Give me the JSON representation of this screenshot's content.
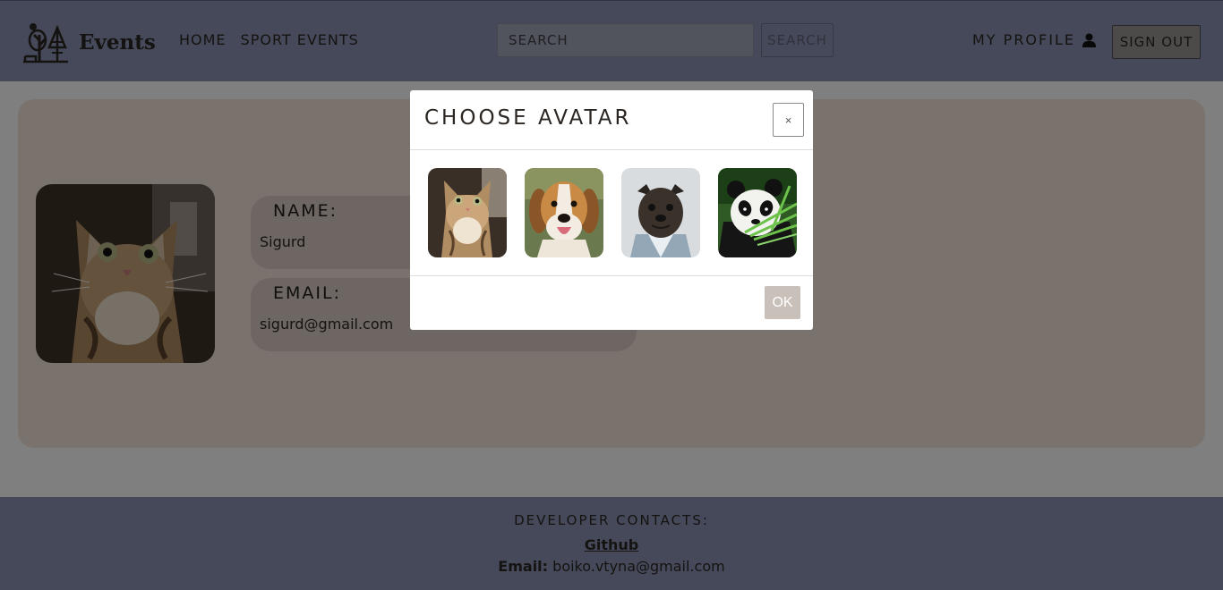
{
  "header": {
    "logo_text": "Events",
    "nav": [
      "HOME",
      "SPORT EVENTS"
    ],
    "search_placeholder": "SEARCH",
    "search_button": "SEARCH",
    "profile_label": "MY PROFILE",
    "signout_label": "SIGN OUT"
  },
  "profile": {
    "name_label": "NAME:",
    "name_value": "Sigurd",
    "email_label": "EMAIL:",
    "email_value": "sigurd@gmail.com"
  },
  "modal": {
    "title": "CHOOSE AVATAR",
    "close": "×",
    "ok": "OK",
    "avatars": [
      "cat",
      "beagle",
      "pug",
      "panda"
    ]
  },
  "footer": {
    "title": "DEVELOPER CONTACTS:",
    "github": "Github",
    "email_label": "Email:",
    "email_value": "boiko.vtyna@gmail.com"
  }
}
